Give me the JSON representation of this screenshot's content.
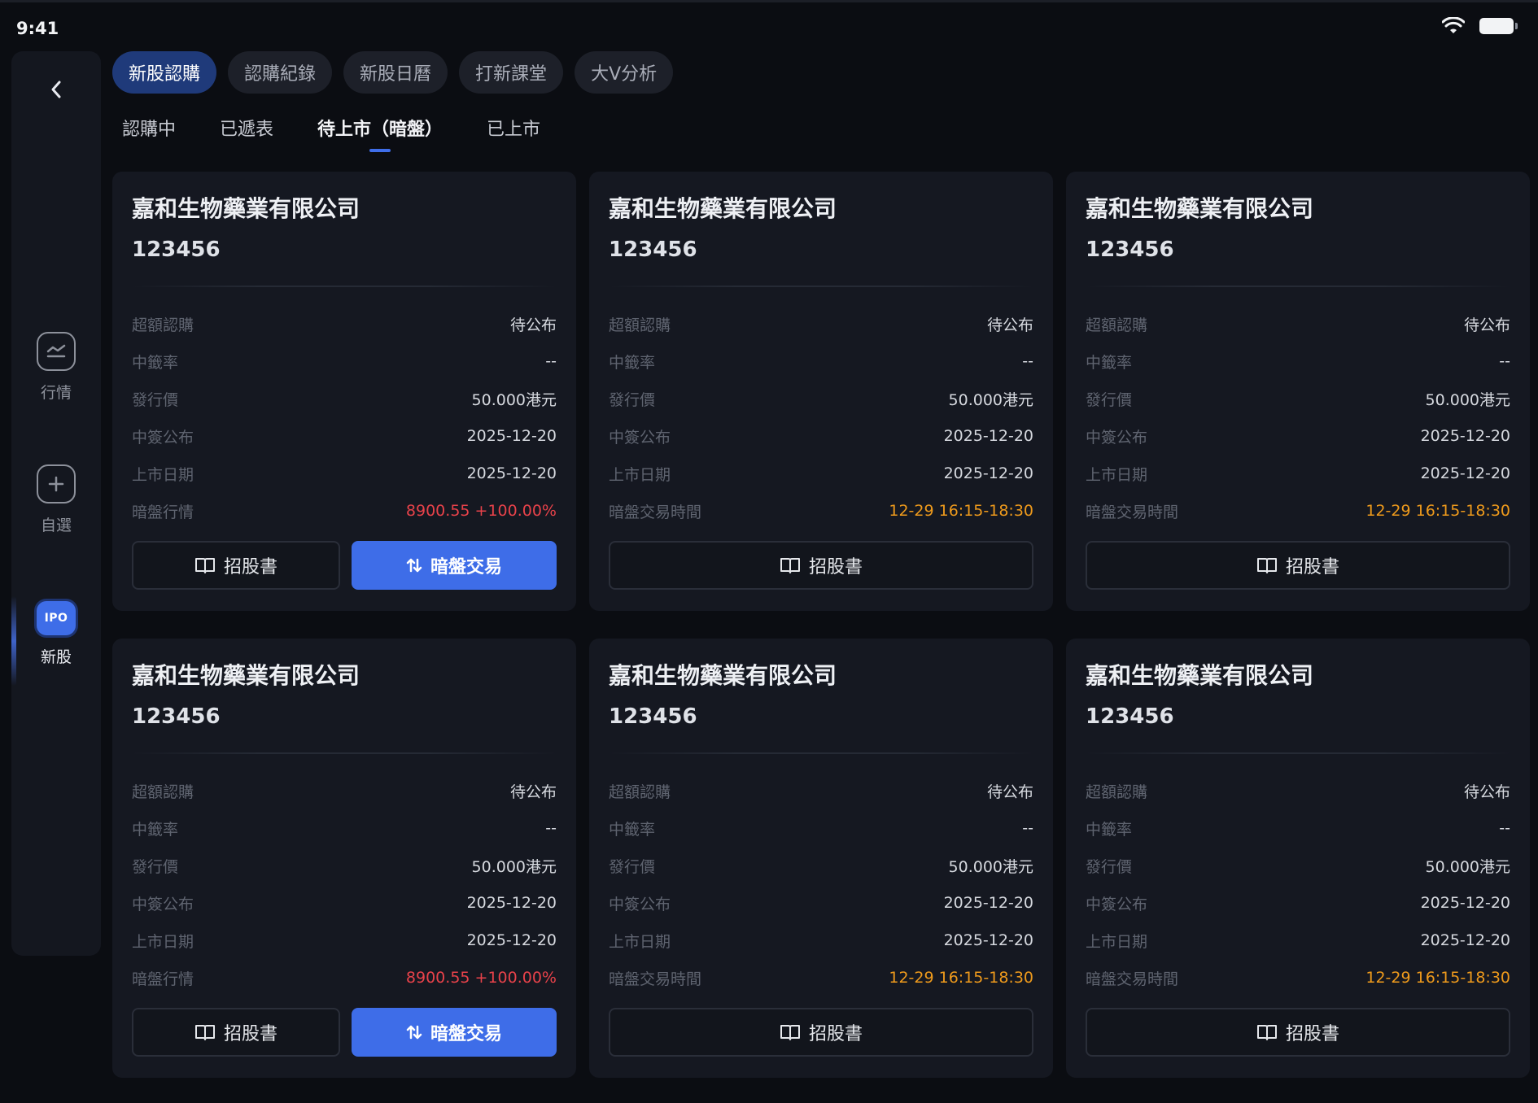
{
  "status": {
    "time": "9:41"
  },
  "sidebar": {
    "items": [
      {
        "label": "行情",
        "icon": "chart-icon"
      },
      {
        "label": "自選",
        "icon": "plus-icon"
      },
      {
        "label": "新股",
        "icon": "ipo-icon",
        "badge": "IPO"
      }
    ]
  },
  "top_tabs": [
    "新股認購",
    "認購紀錄",
    "新股日曆",
    "打新課堂",
    "大V分析"
  ],
  "sub_tabs": [
    "認購中",
    "已遞表",
    "待上市（暗盤）",
    "已上市"
  ],
  "labels": {
    "oversub": "超額認購",
    "win_rate": "中籤率",
    "price": "發行價",
    "allot": "中簽公布",
    "listing": "上市日期",
    "grey": "暗盤行情",
    "grey_time": "暗盤交易時間",
    "prospectus": "招股書",
    "grey_trade": "暗盤交易"
  },
  "cards": [
    {
      "name": "嘉和生物藥業有限公司",
      "code": "123456",
      "oversub": "待公布",
      "win_rate": "--",
      "price": "50.000港元",
      "allot": "2025-12-20",
      "listing": "2025-12-20",
      "grey_value": "8900.55 +100.00%"
    },
    {
      "name": "嘉和生物藥業有限公司",
      "code": "123456",
      "oversub": "待公布",
      "win_rate": "--",
      "price": "50.000港元",
      "allot": "2025-12-20",
      "listing": "2025-12-20",
      "grey_time_value": "12-29 16:15-18:30"
    },
    {
      "name": "嘉和生物藥業有限公司",
      "code": "123456",
      "oversub": "待公布",
      "win_rate": "--",
      "price": "50.000港元",
      "allot": "2025-12-20",
      "listing": "2025-12-20",
      "grey_time_value": "12-29 16:15-18:30"
    },
    {
      "name": "嘉和生物藥業有限公司",
      "code": "123456",
      "oversub": "待公布",
      "win_rate": "--",
      "price": "50.000港元",
      "allot": "2025-12-20",
      "listing": "2025-12-20",
      "grey_value": "8900.55 +100.00%"
    },
    {
      "name": "嘉和生物藥業有限公司",
      "code": "123456",
      "oversub": "待公布",
      "win_rate": "--",
      "price": "50.000港元",
      "allot": "2025-12-20",
      "listing": "2025-12-20",
      "grey_time_value": "12-29 16:15-18:30"
    },
    {
      "name": "嘉和生物藥業有限公司",
      "code": "123456",
      "oversub": "待公布",
      "win_rate": "--",
      "price": "50.000港元",
      "allot": "2025-12-20",
      "listing": "2025-12-20",
      "grey_time_value": "12-29 16:15-18:30"
    }
  ],
  "colors": {
    "accent": "#3e6de8",
    "up_red": "#e8424a",
    "time_orange": "#ee9a1c",
    "card_bg": "#151821"
  }
}
